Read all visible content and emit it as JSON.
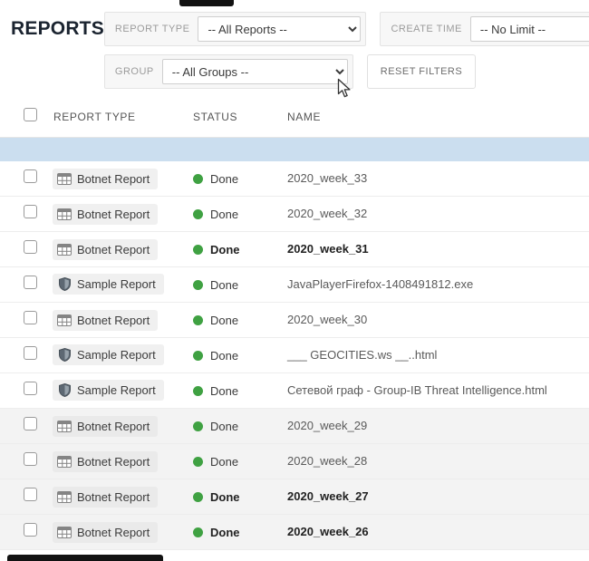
{
  "page": {
    "title": "REPORTS"
  },
  "filters": {
    "report_type": {
      "label": "REPORT TYPE",
      "selected": "-- All Reports --"
    },
    "create_time": {
      "label": "CREATE TIME",
      "selected": "-- No Limit --"
    },
    "group": {
      "label": "GROUP",
      "selected": "-- All Groups --"
    },
    "reset_label": "RESET FILTERS"
  },
  "table": {
    "columns": {
      "type": "REPORT TYPE",
      "status": "STATUS",
      "name": "NAME"
    },
    "status_color": "#3fa142",
    "highlight_color": "#cbdeef",
    "rows": [
      {
        "type": "Botnet Report",
        "icon": "table",
        "status": "Done",
        "name": "2020_week_33",
        "bold": false,
        "shaded": false
      },
      {
        "type": "Botnet Report",
        "icon": "table",
        "status": "Done",
        "name": "2020_week_32",
        "bold": false,
        "shaded": false
      },
      {
        "type": "Botnet Report",
        "icon": "table",
        "status": "Done",
        "name": "2020_week_31",
        "bold": true,
        "shaded": false
      },
      {
        "type": "Sample Report",
        "icon": "shield",
        "status": "Done",
        "name": "JavaPlayerFirefox-1408491812.exe",
        "bold": false,
        "shaded": false
      },
      {
        "type": "Botnet Report",
        "icon": "table",
        "status": "Done",
        "name": "2020_week_30",
        "bold": false,
        "shaded": false
      },
      {
        "type": "Sample Report",
        "icon": "shield",
        "status": "Done",
        "name": "___ GEOCITIES.ws __..html",
        "bold": false,
        "shaded": false
      },
      {
        "type": "Sample Report",
        "icon": "shield",
        "status": "Done",
        "name": "Сетевой граф - Group-IB Threat Intelligence.html",
        "bold": false,
        "shaded": false
      },
      {
        "type": "Botnet Report",
        "icon": "table",
        "status": "Done",
        "name": "2020_week_29",
        "bold": false,
        "shaded": true
      },
      {
        "type": "Botnet Report",
        "icon": "table",
        "status": "Done",
        "name": "2020_week_28",
        "bold": false,
        "shaded": true
      },
      {
        "type": "Botnet Report",
        "icon": "table",
        "status": "Done",
        "name": "2020_week_27",
        "bold": true,
        "shaded": true
      },
      {
        "type": "Botnet Report",
        "icon": "table",
        "status": "Done",
        "name": "2020_week_26",
        "bold": true,
        "shaded": true
      }
    ]
  }
}
